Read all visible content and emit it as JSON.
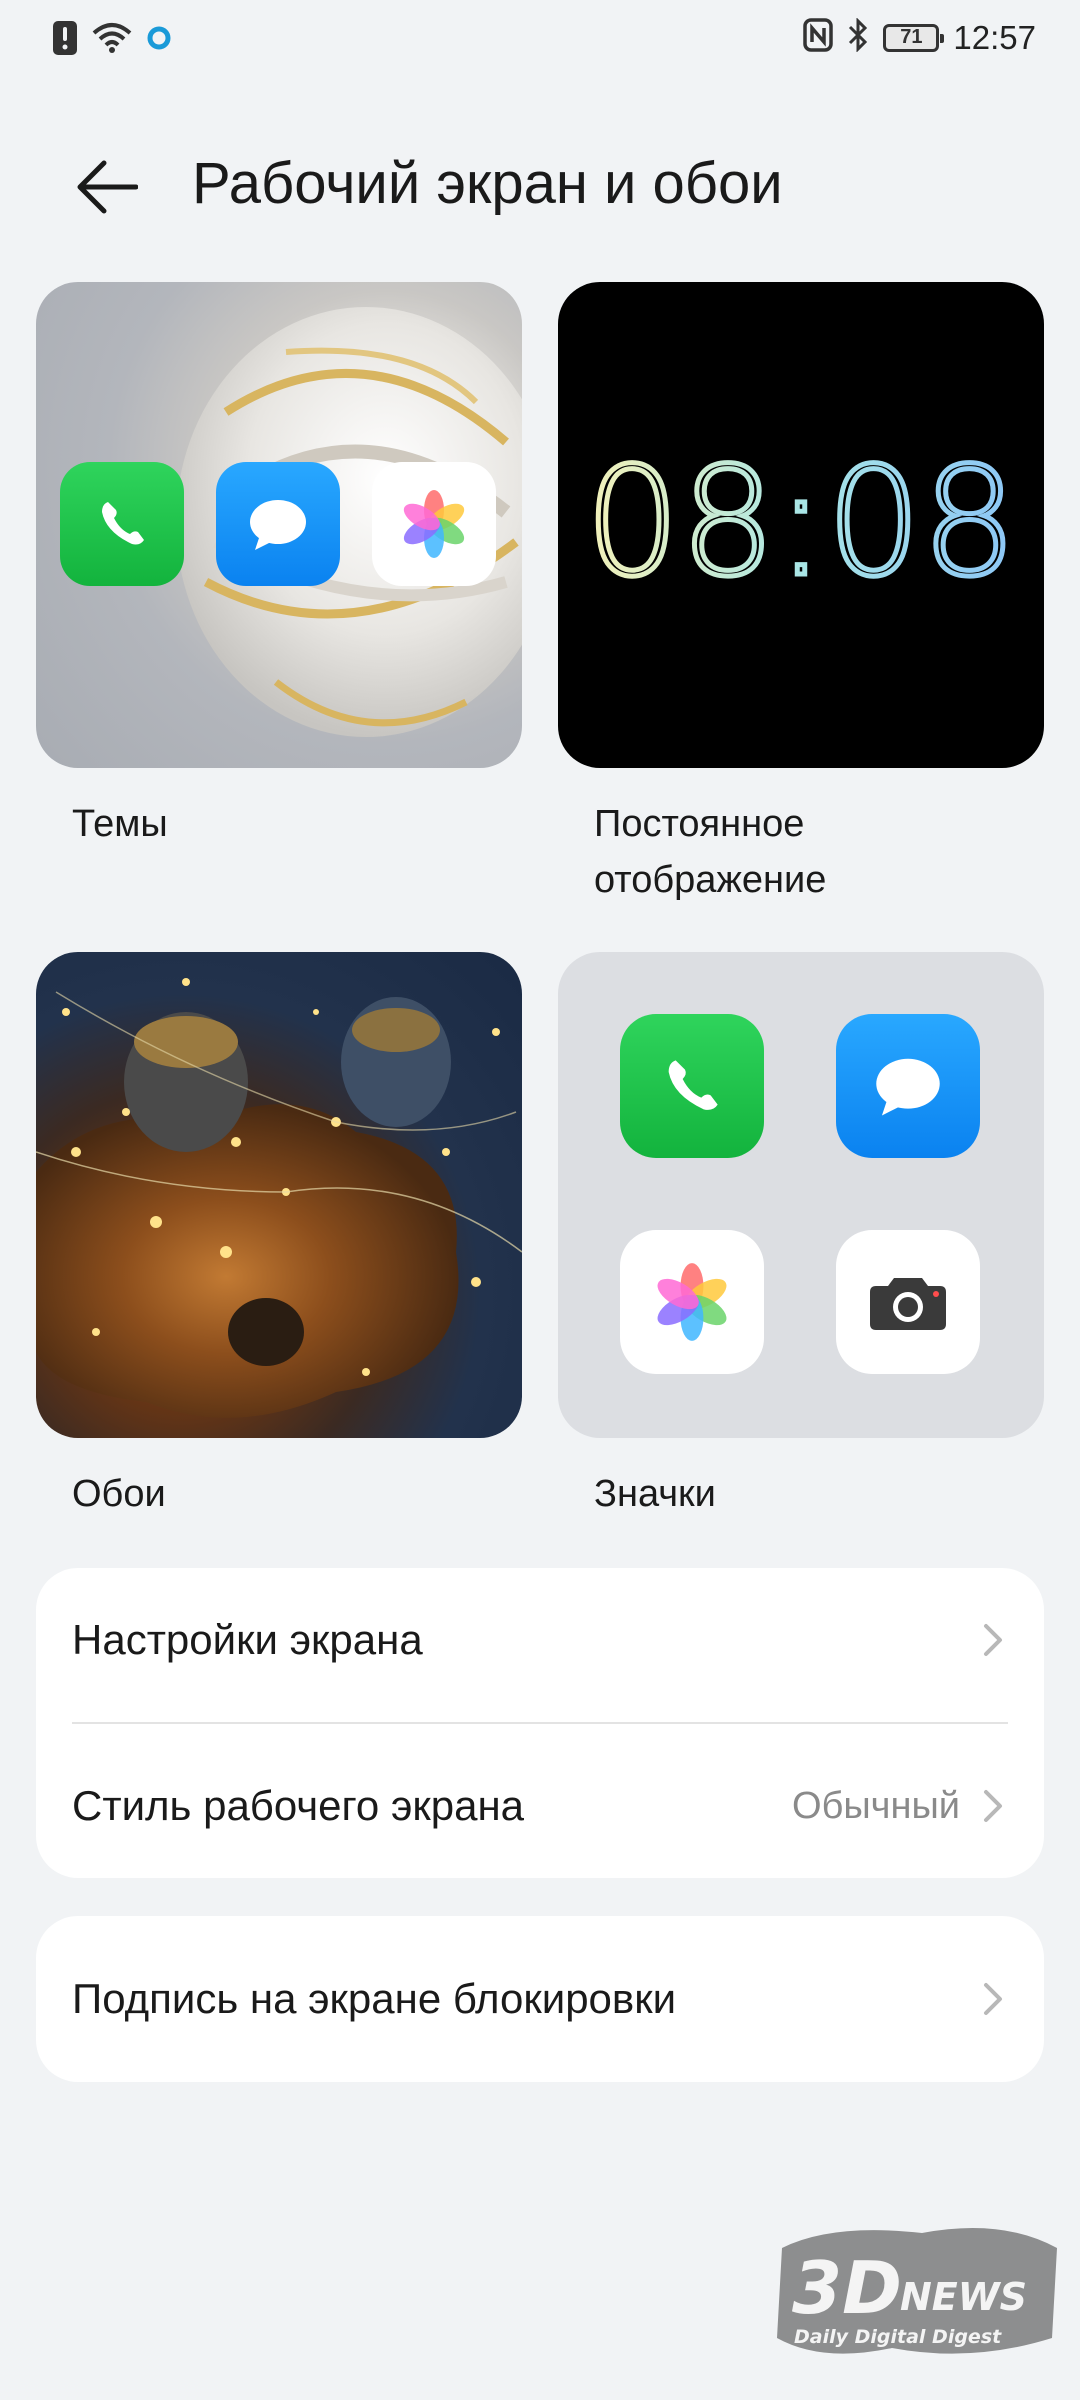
{
  "status_bar": {
    "time": "12:57",
    "battery": "71",
    "left_icons": [
      "alert-icon",
      "wifi-icon",
      "app-indicator-icon"
    ],
    "right_icons": [
      "nfc-icon",
      "bluetooth-icon",
      "battery-icon"
    ]
  },
  "header": {
    "back_icon": "arrow-left-icon",
    "title": "Рабочий экран и обои"
  },
  "tiles": {
    "themes": {
      "label": "Темы",
      "icons": [
        "phone-icon",
        "messages-icon",
        "gallery-icon"
      ]
    },
    "aod": {
      "label_line1": "Постоянное",
      "label_line2": "отображение",
      "clock": "08:08"
    },
    "wallpaper": {
      "label": "Обои"
    },
    "icons": {
      "label": "Значки",
      "icons": [
        "phone-icon",
        "messages-icon",
        "gallery-icon",
        "camera-icon"
      ]
    }
  },
  "settings": {
    "display": {
      "label": "Настройки экрана"
    },
    "home_style": {
      "label": "Стиль рабочего экрана",
      "value": "Обычный"
    },
    "lock_signature": {
      "label": "Подпись на экране блокировки"
    }
  },
  "watermark": {
    "logo": "3DNEWS",
    "tagline": "Daily Digital Digest"
  },
  "colors": {
    "background": "#f1f3f5",
    "card": "#ffffff",
    "phone_green": "#1fc64b",
    "messages_blue": "#1a95f8",
    "clock_gradient": [
      "#f4f1b8",
      "#a9e6e6",
      "#8cc6f6"
    ]
  }
}
